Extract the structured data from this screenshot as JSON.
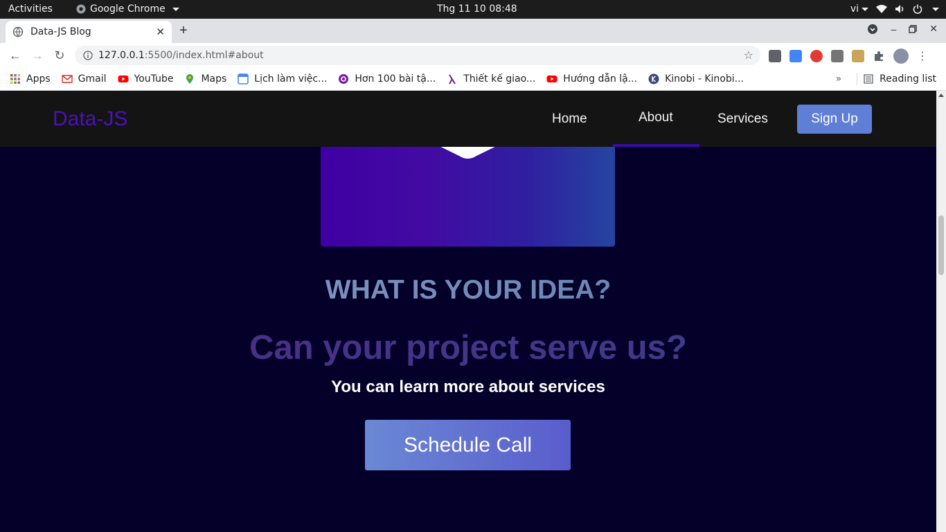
{
  "system_bar": {
    "activities": "Activities",
    "app_name": "Google Chrome",
    "clock": "Thg 11 10  08:48",
    "language": "vi"
  },
  "browser": {
    "tab_title": "Data-JS Blog",
    "url_host": "127.0.0.1",
    "url_path": ":5500/index.html#about",
    "bookmarks": [
      {
        "label": "Apps",
        "icon": "apps-grid-icon",
        "color": "#ea4335"
      },
      {
        "label": "Gmail",
        "icon": "gmail-icon",
        "color": "#d93025"
      },
      {
        "label": "YouTube",
        "icon": "youtube-icon",
        "color": "#ff0000"
      },
      {
        "label": "Maps",
        "icon": "maps-icon",
        "color": "#34a853"
      },
      {
        "label": "Lịch làm việc...",
        "icon": "calendar-icon",
        "color": "#4285f4"
      },
      {
        "label": "Hơn 100 bài tậ...",
        "icon": "at-icon",
        "color": "#7b1fa2"
      },
      {
        "label": "Thiết kế giao...",
        "icon": "lambda-icon",
        "color": "#6a1b9a"
      },
      {
        "label": "Hướng dẫn lậ...",
        "icon": "youtube-icon",
        "color": "#ff0000"
      },
      {
        "label": "Kinobi - Kinobi...",
        "icon": "kinobi-icon",
        "color": "#3b4a7a"
      }
    ],
    "more_bookmarks": "»",
    "reading_list": "Reading list"
  },
  "site": {
    "logo": "Data-JS",
    "nav": {
      "home": "Home",
      "about": "About",
      "services": "Services",
      "signup": "Sign Up"
    },
    "heading_idea": "WHAT IS YOUR IDEA?",
    "heading_serve": "Can your project serve us?",
    "subheading": "You can learn more about services",
    "cta": "Schedule Call"
  },
  "colors": {
    "page_bg": "#05002a",
    "navbar_bg": "#141414",
    "logo": "#4b12b8",
    "accent_underline": "#3a0ca3",
    "signup_button": "#5f7fd6"
  }
}
